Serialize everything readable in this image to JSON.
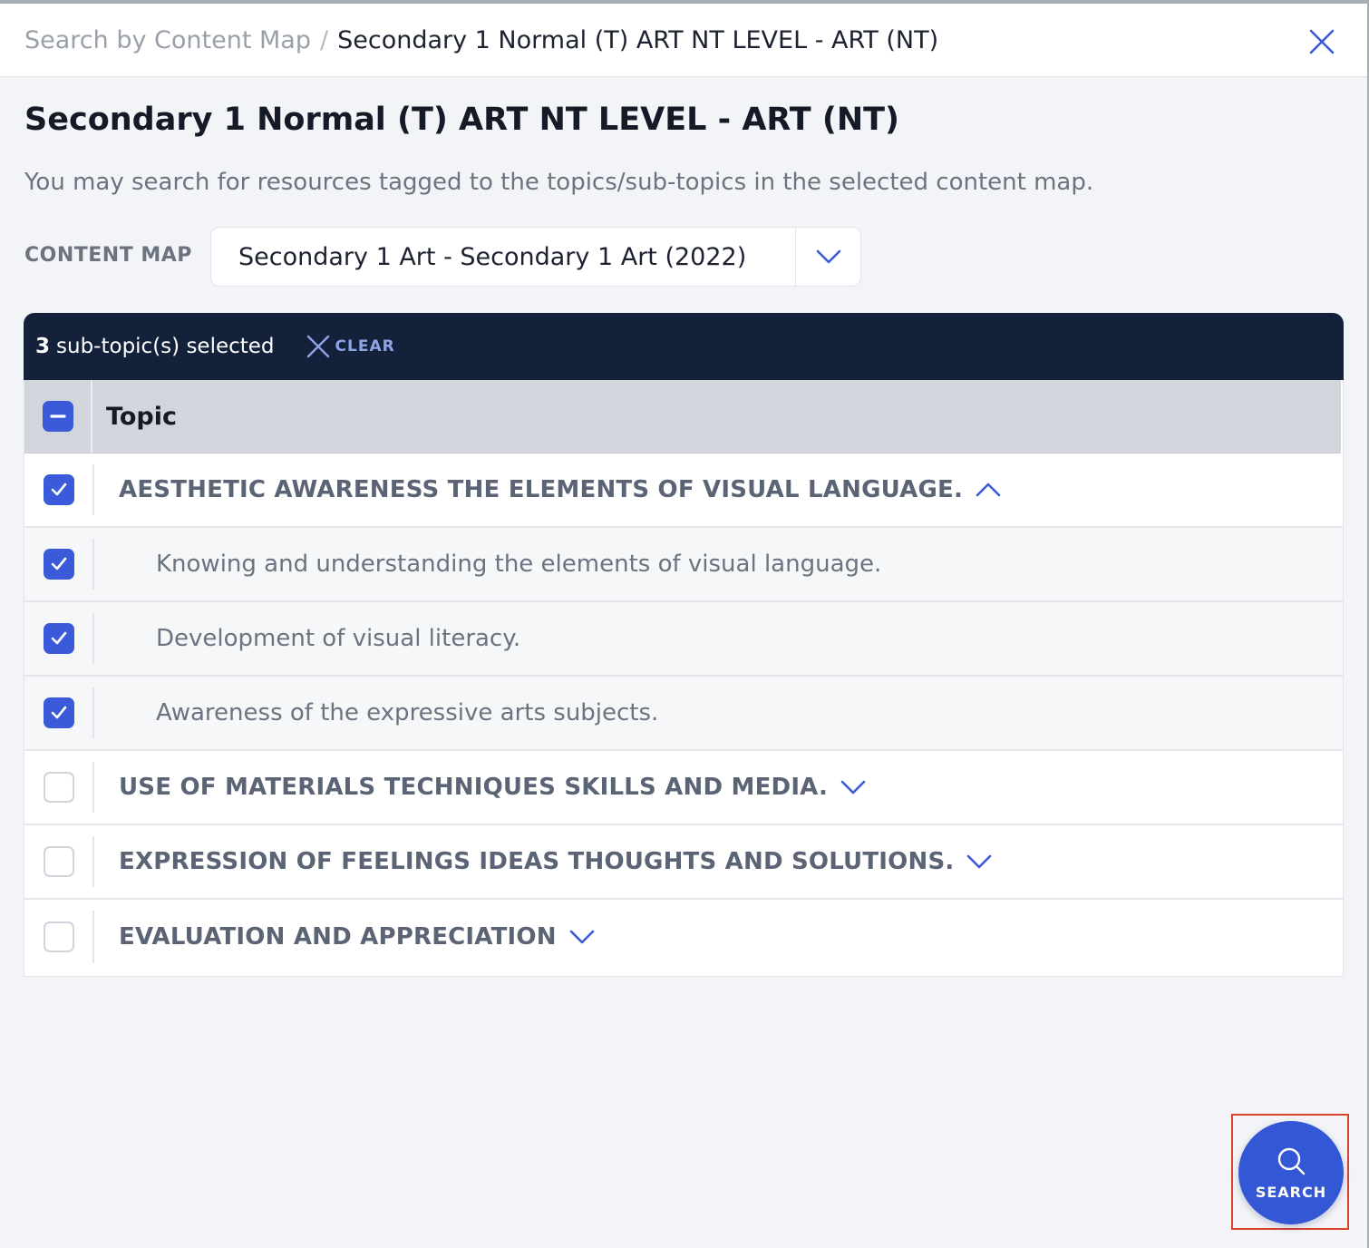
{
  "header": {
    "breadcrumb_root": "Search by Content Map",
    "breadcrumb_separator": "/",
    "breadcrumb_current": "Secondary 1 Normal (T) ART NT LEVEL - ART (NT)",
    "close_icon": "close-icon"
  },
  "page": {
    "title": "Secondary 1 Normal (T) ART NT LEVEL - ART (NT)",
    "description": "You may search for resources tagged to the topics/sub-topics in the selected content map."
  },
  "content_map": {
    "label": "CONTENT MAP",
    "selected": "Secondary 1 Art - Secondary 1 Art (2022)"
  },
  "selection_bar": {
    "count": "3",
    "text": "sub-topic(s) selected",
    "clear_label": "CLEAR"
  },
  "table": {
    "header": "Topic",
    "rows": [
      {
        "type": "topic",
        "label": "AESTHETIC AWARENESS THE ELEMENTS OF VISUAL LANGUAGE.",
        "checked": true,
        "expanded": true
      },
      {
        "type": "sub",
        "label": "Knowing and understanding the elements of visual language.",
        "checked": true
      },
      {
        "type": "sub",
        "label": "Development of visual literacy.",
        "checked": true
      },
      {
        "type": "sub",
        "label": "Awareness of the expressive arts subjects.",
        "checked": true
      },
      {
        "type": "topic",
        "label": "USE OF MATERIALS TECHNIQUES SKILLS AND MEDIA.",
        "checked": false,
        "expanded": false
      },
      {
        "type": "topic",
        "label": "EXPRESSION OF FEELINGS IDEAS THOUGHTS AND SOLUTIONS.",
        "checked": false,
        "expanded": false
      },
      {
        "type": "topic",
        "label": "EVALUATION AND APPRECIATION",
        "checked": false,
        "expanded": false
      }
    ]
  },
  "search_button": {
    "label": "SEARCH",
    "icon": "search-icon"
  },
  "colors": {
    "accent": "#3458d5",
    "selection_bar": "#14213b",
    "highlight_border": "#d7432f"
  }
}
